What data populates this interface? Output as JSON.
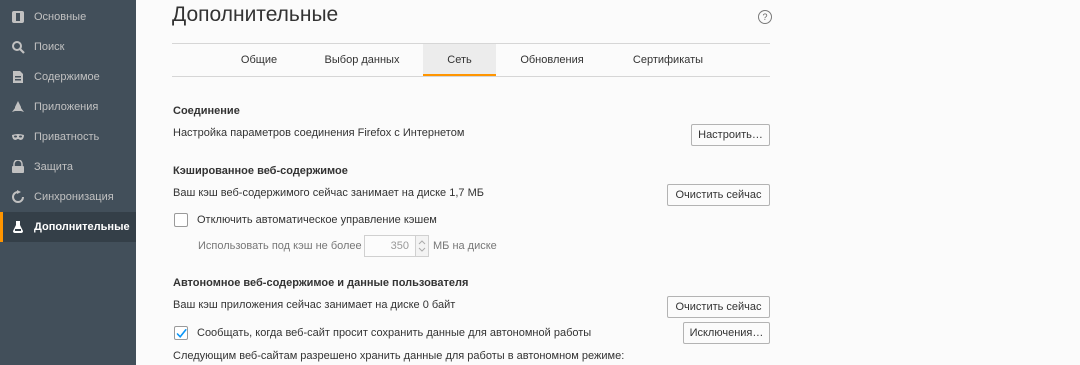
{
  "sidebar": {
    "items": [
      {
        "label": "Основные",
        "icon": "general-icon"
      },
      {
        "label": "Поиск",
        "icon": "search-icon"
      },
      {
        "label": "Содержимое",
        "icon": "content-icon"
      },
      {
        "label": "Приложения",
        "icon": "applications-icon"
      },
      {
        "label": "Приватность",
        "icon": "privacy-mask-icon"
      },
      {
        "label": "Защита",
        "icon": "security-icon"
      },
      {
        "label": "Синхронизация",
        "icon": "sync-icon"
      },
      {
        "label": "Дополнительные",
        "icon": "advanced-icon",
        "active": true
      }
    ]
  },
  "header": {
    "title": "Дополнительные",
    "help": "?"
  },
  "tabs": [
    {
      "label": "Общие"
    },
    {
      "label": "Выбор данных"
    },
    {
      "label": "Сеть",
      "active": true
    },
    {
      "label": "Обновления"
    },
    {
      "label": "Сертификаты"
    }
  ],
  "connection": {
    "title": "Соединение",
    "description": "Настройка параметров соединения Firefox с Интернетом",
    "button": "Настроить…"
  },
  "cache": {
    "title": "Кэшированное веб-содержимое",
    "description": "Ваш кэш веб-содержимого сейчас занимает на диске 1,7 МБ",
    "button": "Очистить сейчас",
    "override_checkbox": "Отключить автоматическое управление кэшем",
    "override_checked": false,
    "limit_label": "Использовать под кэш не более",
    "limit_value": "350",
    "limit_unit": "МБ на диске"
  },
  "offline": {
    "title": "Автономное веб-содержимое и данные пользователя",
    "description": "Ваш кэш приложения сейчас занимает на диске 0 байт",
    "button": "Очистить сейчас",
    "notify_checkbox": "Сообщать, когда веб-сайт просит сохранить данные для автономной работы",
    "notify_checked": true,
    "exceptions_button": "Исключения…",
    "allowed_sites_label": "Следующим веб-сайтам разрешено хранить данные для работы в автономном режиме:"
  },
  "colors": {
    "sidebar_bg": "#424f5a",
    "accent": "#ff9500",
    "checkbox_check": "#0996f8"
  }
}
